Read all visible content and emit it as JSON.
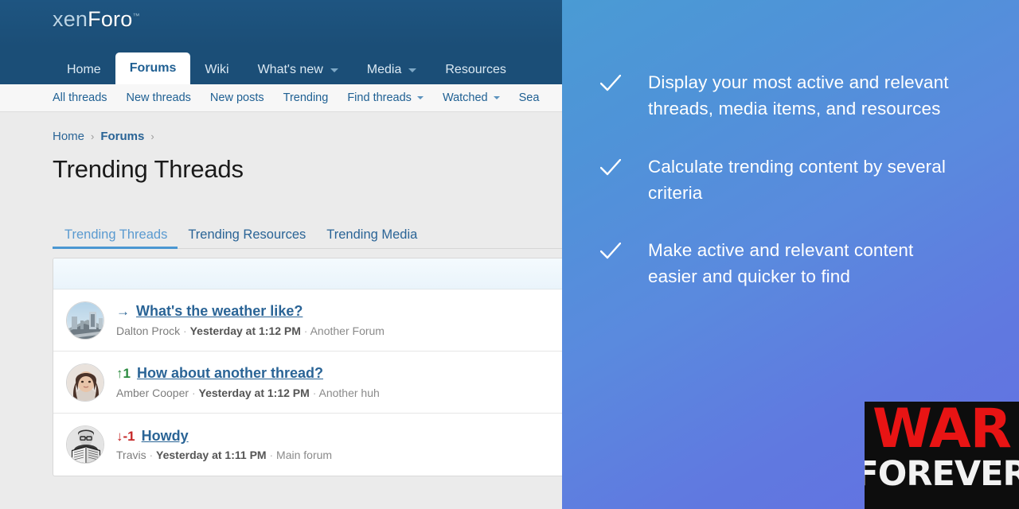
{
  "forum": {
    "logo": {
      "prefix": "xen",
      "suffix": "Foro",
      "tm": "™"
    },
    "nav": [
      {
        "label": "Home",
        "has_caret": false,
        "active": false
      },
      {
        "label": "Forums",
        "has_caret": false,
        "active": true
      },
      {
        "label": "Wiki",
        "has_caret": false,
        "active": false
      },
      {
        "label": "What's new",
        "has_caret": true,
        "active": false
      },
      {
        "label": "Media",
        "has_caret": true,
        "active": false
      },
      {
        "label": "Resources",
        "has_caret": false,
        "active": false
      }
    ],
    "subnav": [
      {
        "label": "All threads",
        "has_caret": false
      },
      {
        "label": "New threads",
        "has_caret": false
      },
      {
        "label": "New posts",
        "has_caret": false
      },
      {
        "label": "Trending",
        "has_caret": false
      },
      {
        "label": "Find threads",
        "has_caret": true
      },
      {
        "label": "Watched",
        "has_caret": true
      },
      {
        "label": "Sea",
        "has_caret": false
      }
    ],
    "breadcrumb": [
      {
        "label": "Home",
        "bold": false
      },
      {
        "label": "Forums",
        "bold": true
      }
    ],
    "breadcrumb_separator": "›",
    "page_title": "Trending Threads",
    "tabs": [
      {
        "label": "Trending Threads",
        "active": true
      },
      {
        "label": "Trending Resources",
        "active": false
      },
      {
        "label": "Trending Media",
        "active": false
      }
    ],
    "threads": [
      {
        "trend_symbol": "→",
        "trend_value": "",
        "trend_direction": "flat",
        "title": "What's the weather like?",
        "author": "Dalton Prock",
        "date": "Yesterday at 1:12 PM",
        "node": "Another Forum",
        "avatar": "cityscape-photo"
      },
      {
        "trend_symbol": "↑",
        "trend_value": "1",
        "trend_direction": "up",
        "title": "How about another thread?",
        "author": "Amber Cooper",
        "date": "Yesterday at 1:12 PM",
        "node": "Another huh",
        "avatar": "woman-portrait-photo"
      },
      {
        "trend_symbol": "↓",
        "trend_value": "-1",
        "trend_direction": "down",
        "title": "Howdy",
        "author": "Travis",
        "date": "Yesterday at 1:11 PM",
        "node": "Main forum",
        "avatar": "man-reading-photo"
      }
    ],
    "meta_separator": "·"
  },
  "promo": {
    "bullets": [
      {
        "icon": "check-icon",
        "text": "Display your most active and relevant threads, media items, and resources"
      },
      {
        "icon": "check-icon",
        "text": "Calculate trending content by several criteria"
      },
      {
        "icon": "check-icon",
        "text": "Make active and relevant content easier and quicker to find"
      }
    ],
    "watermark": {
      "line1": "WAR",
      "line2": "FOREVER"
    }
  },
  "colors": {
    "header_blue": "#1b4e77",
    "link_blue": "#2a6496",
    "tab_active": "#4a97d2",
    "trend_up": "#2a8a3e",
    "trend_down": "#c62828",
    "promo_gradient_start": "#4a9bd4",
    "promo_gradient_end": "#6370e2",
    "watermark_red": "#e81414"
  }
}
